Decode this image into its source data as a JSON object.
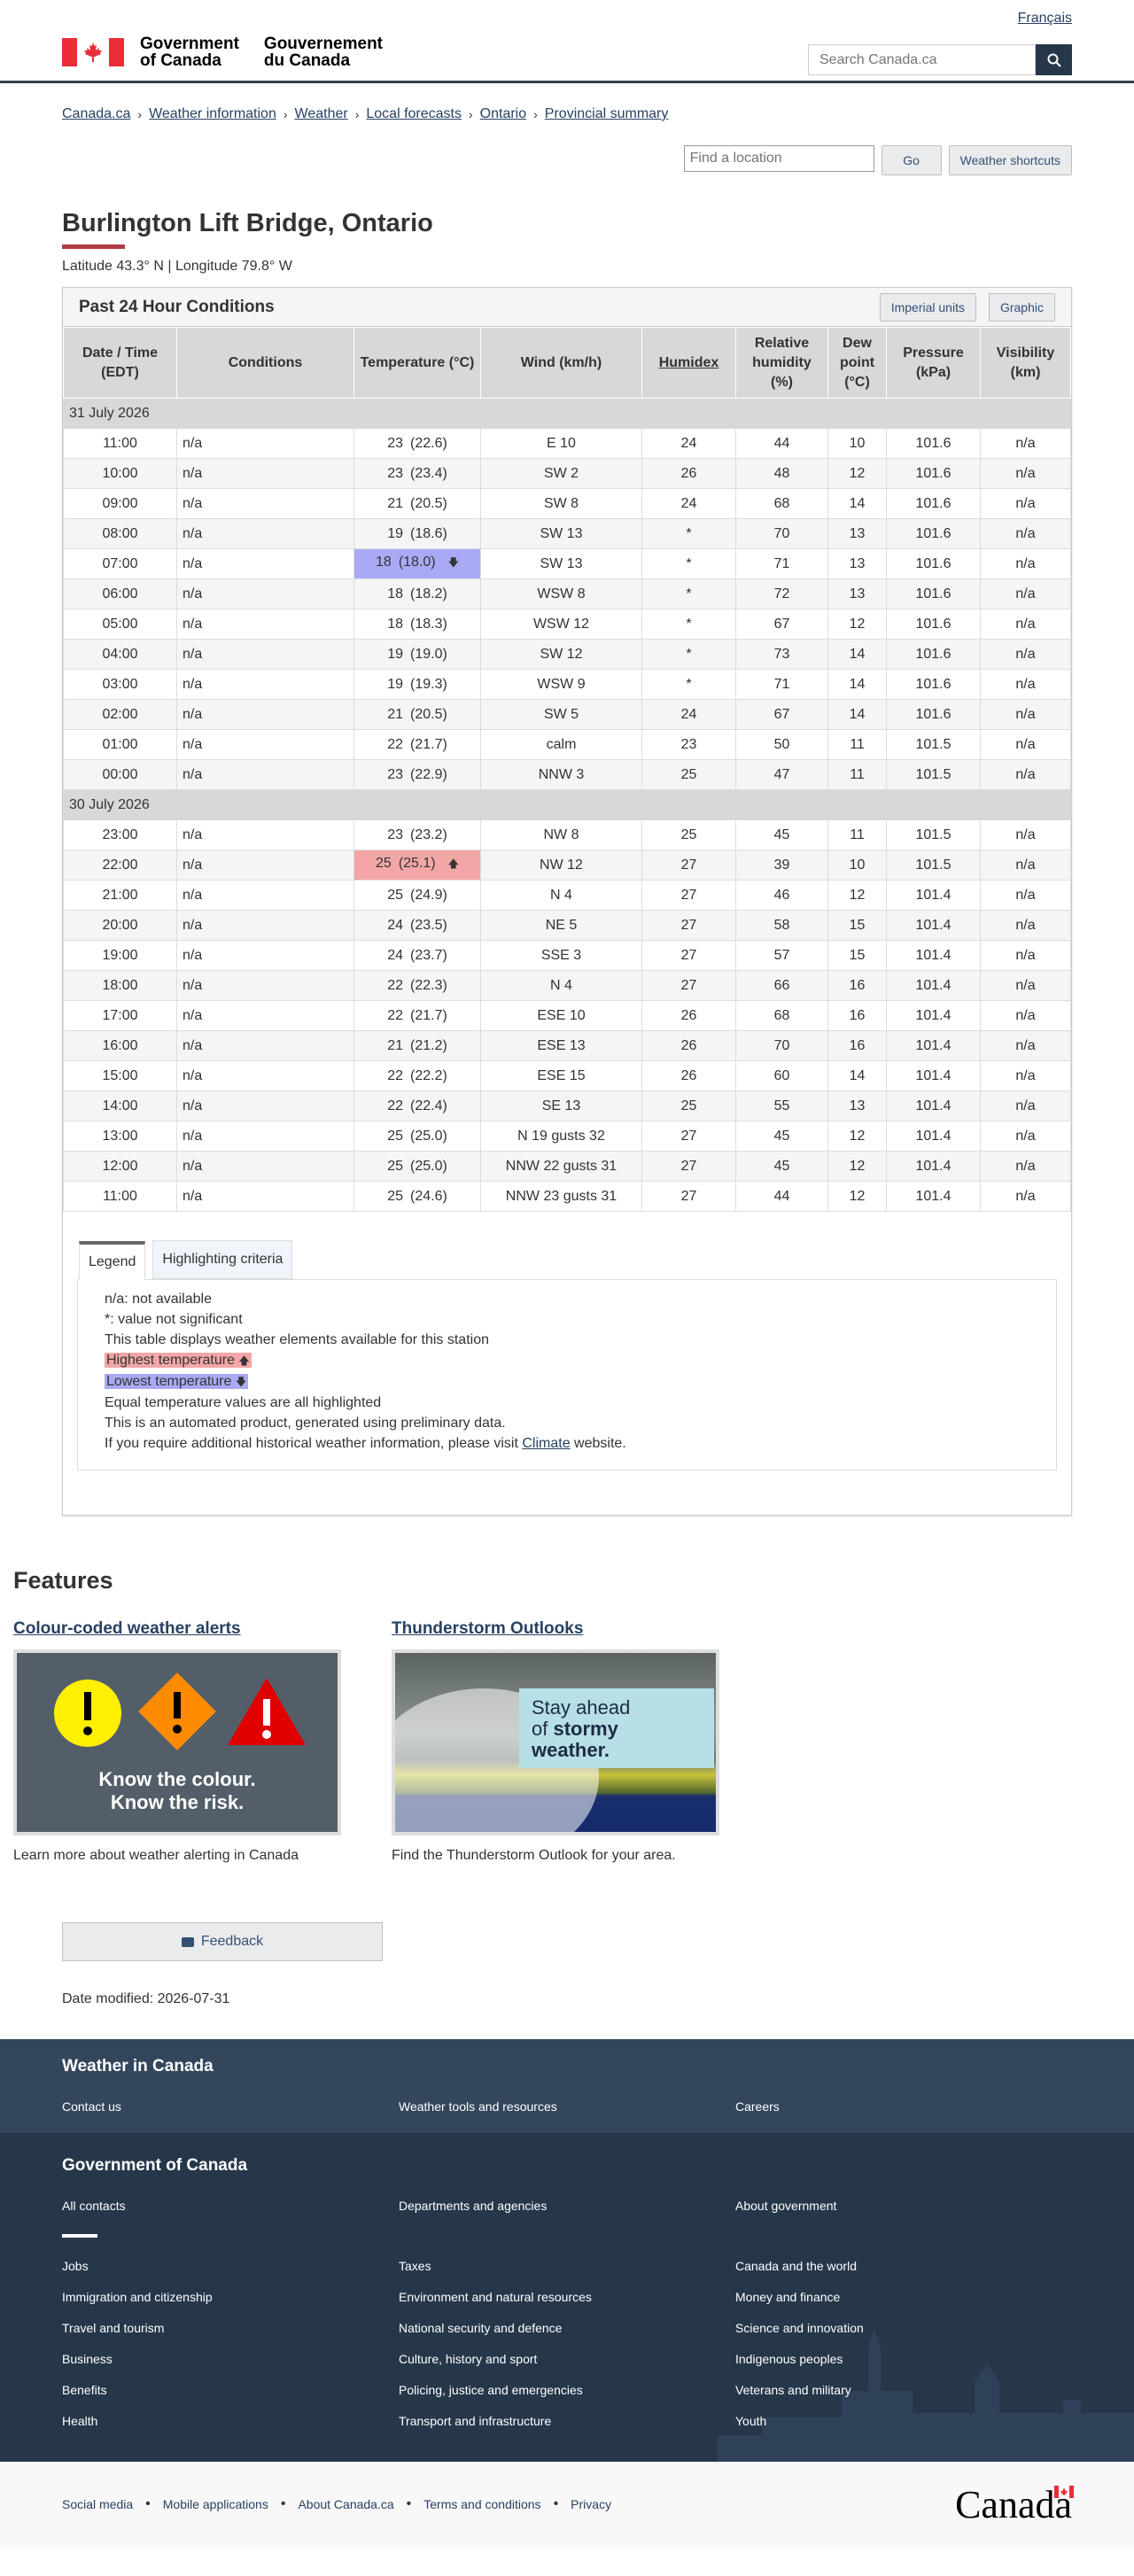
{
  "header": {
    "language_link": "Français",
    "gov_en": [
      "Government",
      "of Canada"
    ],
    "gov_fr": [
      "Gouvernement",
      "du Canada"
    ],
    "search_placeholder": "Search Canada.ca"
  },
  "breadcrumb": [
    "Canada.ca",
    "Weather information",
    "Weather",
    "Local forecasts",
    "Ontario",
    "Provincial summary"
  ],
  "tools": {
    "location_placeholder": "Find a location",
    "go_label": "Go",
    "shortcuts_label": "Weather shortcuts"
  },
  "page": {
    "title": "Burlington Lift Bridge, Ontario",
    "latlon": "Latitude 43.3° N | Longitude 79.8° W"
  },
  "panel": {
    "title": "Past 24 Hour Conditions",
    "imperial_label": "Imperial units",
    "graphic_label": "Graphic"
  },
  "table": {
    "headers": [
      "Date / Time (EDT)",
      "Conditions",
      "Temperature (°C)",
      "Wind (km/h)",
      "Humidex",
      "Relative humidity (%)",
      "Dew point (°C)",
      "Pressure (kPa)",
      "Visibility (km)"
    ],
    "groups": [
      {
        "date": "31 July 2026",
        "rows": [
          {
            "time": "11:00",
            "cond": "n/a",
            "temp": "23",
            "feels": "(22.6)",
            "wind": "E 10",
            "humidex": "24",
            "rh": "44",
            "dew": "10",
            "press": "101.6",
            "vis": "n/a"
          },
          {
            "time": "10:00",
            "cond": "n/a",
            "temp": "23",
            "feels": "(23.4)",
            "wind": "SW 2",
            "humidex": "26",
            "rh": "48",
            "dew": "12",
            "press": "101.6",
            "vis": "n/a"
          },
          {
            "time": "09:00",
            "cond": "n/a",
            "temp": "21",
            "feels": "(20.5)",
            "wind": "SW 8",
            "humidex": "24",
            "rh": "68",
            "dew": "14",
            "press": "101.6",
            "vis": "n/a"
          },
          {
            "time": "08:00",
            "cond": "n/a",
            "temp": "19",
            "feels": "(18.6)",
            "wind": "SW 13",
            "humidex": "*",
            "rh": "70",
            "dew": "13",
            "press": "101.6",
            "vis": "n/a"
          },
          {
            "time": "07:00",
            "cond": "n/a",
            "temp": "18",
            "feels": "(18.0)",
            "wind": "SW 13",
            "humidex": "*",
            "rh": "71",
            "dew": "13",
            "press": "101.6",
            "vis": "n/a",
            "mark": "lo"
          },
          {
            "time": "06:00",
            "cond": "n/a",
            "temp": "18",
            "feels": "(18.2)",
            "wind": "WSW 8",
            "humidex": "*",
            "rh": "72",
            "dew": "13",
            "press": "101.6",
            "vis": "n/a"
          },
          {
            "time": "05:00",
            "cond": "n/a",
            "temp": "18",
            "feels": "(18.3)",
            "wind": "WSW 12",
            "humidex": "*",
            "rh": "67",
            "dew": "12",
            "press": "101.6",
            "vis": "n/a"
          },
          {
            "time": "04:00",
            "cond": "n/a",
            "temp": "19",
            "feels": "(19.0)",
            "wind": "SW 12",
            "humidex": "*",
            "rh": "73",
            "dew": "14",
            "press": "101.6",
            "vis": "n/a"
          },
          {
            "time": "03:00",
            "cond": "n/a",
            "temp": "19",
            "feels": "(19.3)",
            "wind": "WSW 9",
            "humidex": "*",
            "rh": "71",
            "dew": "14",
            "press": "101.6",
            "vis": "n/a"
          },
          {
            "time": "02:00",
            "cond": "n/a",
            "temp": "21",
            "feels": "(20.5)",
            "wind": "SW 5",
            "humidex": "24",
            "rh": "67",
            "dew": "14",
            "press": "101.6",
            "vis": "n/a"
          },
          {
            "time": "01:00",
            "cond": "n/a",
            "temp": "22",
            "feels": "(21.7)",
            "wind": "calm",
            "humidex": "23",
            "rh": "50",
            "dew": "11",
            "press": "101.5",
            "vis": "n/a"
          },
          {
            "time": "00:00",
            "cond": "n/a",
            "temp": "23",
            "feels": "(22.9)",
            "wind": "NNW 3",
            "humidex": "25",
            "rh": "47",
            "dew": "11",
            "press": "101.5",
            "vis": "n/a"
          }
        ]
      },
      {
        "date": "30 July 2026",
        "rows": [
          {
            "time": "23:00",
            "cond": "n/a",
            "temp": "23",
            "feels": "(23.2)",
            "wind": "NW 8",
            "humidex": "25",
            "rh": "45",
            "dew": "11",
            "press": "101.5",
            "vis": "n/a"
          },
          {
            "time": "22:00",
            "cond": "n/a",
            "temp": "25",
            "feels": "(25.1)",
            "wind": "NW 12",
            "humidex": "27",
            "rh": "39",
            "dew": "10",
            "press": "101.5",
            "vis": "n/a",
            "mark": "hi"
          },
          {
            "time": "21:00",
            "cond": "n/a",
            "temp": "25",
            "feels": "(24.9)",
            "wind": "N 4",
            "humidex": "27",
            "rh": "46",
            "dew": "12",
            "press": "101.4",
            "vis": "n/a"
          },
          {
            "time": "20:00",
            "cond": "n/a",
            "temp": "24",
            "feels": "(23.5)",
            "wind": "NE 5",
            "humidex": "27",
            "rh": "58",
            "dew": "15",
            "press": "101.4",
            "vis": "n/a"
          },
          {
            "time": "19:00",
            "cond": "n/a",
            "temp": "24",
            "feels": "(23.7)",
            "wind": "SSE 3",
            "humidex": "27",
            "rh": "57",
            "dew": "15",
            "press": "101.4",
            "vis": "n/a"
          },
          {
            "time": "18:00",
            "cond": "n/a",
            "temp": "22",
            "feels": "(22.3)",
            "wind": "N 4",
            "humidex": "27",
            "rh": "66",
            "dew": "16",
            "press": "101.4",
            "vis": "n/a"
          },
          {
            "time": "17:00",
            "cond": "n/a",
            "temp": "22",
            "feels": "(21.7)",
            "wind": "ESE 10",
            "humidex": "26",
            "rh": "68",
            "dew": "16",
            "press": "101.4",
            "vis": "n/a"
          },
          {
            "time": "16:00",
            "cond": "n/a",
            "temp": "21",
            "feels": "(21.2)",
            "wind": "ESE 13",
            "humidex": "26",
            "rh": "70",
            "dew": "16",
            "press": "101.4",
            "vis": "n/a"
          },
          {
            "time": "15:00",
            "cond": "n/a",
            "temp": "22",
            "feels": "(22.2)",
            "wind": "ESE 15",
            "humidex": "26",
            "rh": "60",
            "dew": "14",
            "press": "101.4",
            "vis": "n/a"
          },
          {
            "time": "14:00",
            "cond": "n/a",
            "temp": "22",
            "feels": "(22.4)",
            "wind": "SE 13",
            "humidex": "25",
            "rh": "55",
            "dew": "13",
            "press": "101.4",
            "vis": "n/a"
          },
          {
            "time": "13:00",
            "cond": "n/a",
            "temp": "25",
            "feels": "(25.0)",
            "wind": "N 19 gusts 32",
            "humidex": "27",
            "rh": "45",
            "dew": "12",
            "press": "101.4",
            "vis": "n/a"
          },
          {
            "time": "12:00",
            "cond": "n/a",
            "temp": "25",
            "feels": "(25.0)",
            "wind": "NNW 22 gusts 31",
            "humidex": "27",
            "rh": "45",
            "dew": "12",
            "press": "101.4",
            "vis": "n/a"
          },
          {
            "time": "11:00",
            "cond": "n/a",
            "temp": "25",
            "feels": "(24.6)",
            "wind": "NNW 23 gusts 31",
            "humidex": "27",
            "rh": "44",
            "dew": "12",
            "press": "101.4",
            "vis": "n/a"
          }
        ]
      }
    ]
  },
  "legend": {
    "tab_legend": "Legend",
    "tab_criteria": "Highlighting criteria",
    "na": "n/a: not available",
    "ns": "*: value not significant",
    "station": "This table displays weather elements available for this station",
    "highest": "Highest temperature",
    "lowest": "Lowest temperature",
    "equal": "Equal temperature values are all highlighted",
    "automated": "This is an automated product, generated using preliminary data.",
    "historical_pre": "If you require additional historical weather information, please visit",
    "historical_link": "Climate",
    "historical_post": "website.",
    "hi_color": "#f3a6a6",
    "lo_color": "#a9a9f6"
  },
  "features": {
    "heading": "Features",
    "card1_title": "Colour-coded weather alerts",
    "card1_img_line1": "Know the colour.",
    "card1_img_line2": "Know the risk.",
    "card1_desc": "Learn more about weather alerting in Canada",
    "card2_title": "Thunderstorm Outlooks",
    "card2_img_line1": "Stay ahead",
    "card2_img_line2a": "of ",
    "card2_img_line2b": "stormy",
    "card2_img_line3": "weather.",
    "card2_desc": "Find the Thunderstorm Outlook for your area."
  },
  "feedback_label": "Feedback",
  "date_modified": "Date modified: 2026-07-31",
  "footer": {
    "weather_title": "Weather in Canada",
    "weather_links": [
      "Contact us",
      "Weather tools and resources",
      "Careers"
    ],
    "gov_title": "Government of Canada",
    "gov_top_links": [
      "All contacts",
      "Departments and agencies",
      "About government"
    ],
    "gov_links": [
      "Jobs",
      "Taxes",
      "Canada and the world",
      "Immigration and citizenship",
      "Environment and natural resources",
      "Money and finance",
      "Travel and tourism",
      "National security and defence",
      "Science and innovation",
      "Business",
      "Culture, history and sport",
      "Indigenous peoples",
      "Benefits",
      "Policing, justice and emergencies",
      "Veterans and military",
      "Health",
      "Transport and infrastructure",
      "Youth"
    ],
    "bottom_links": [
      "Social media",
      "Mobile applications",
      "About Canada.ca",
      "Terms and conditions",
      "Privacy"
    ],
    "wordmark": "Canada"
  }
}
